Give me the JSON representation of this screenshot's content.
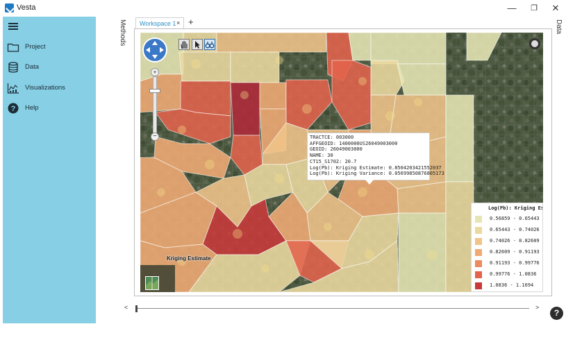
{
  "app": {
    "title": "Vesta"
  },
  "window_controls": {
    "minimize": "—",
    "restore": "❐",
    "close": "✕"
  },
  "sidebar": {
    "items": [
      {
        "label": "Project",
        "icon": "folder-icon"
      },
      {
        "label": "Data",
        "icon": "database-icon"
      },
      {
        "label": "Visualizations",
        "icon": "chart-icon"
      },
      {
        "label": "Help",
        "icon": "help-icon"
      }
    ]
  },
  "panels": {
    "methods": "Methods",
    "data": "Data"
  },
  "tabs": {
    "workspace": "Workspace 1",
    "close": "×",
    "add": "+"
  },
  "map": {
    "overlay_label": "Kriging Estimate",
    "tooltip": [
      "TRACTCE: 003000",
      "AFFGEOID: 1400000US26049003000",
      "GEOID: 26049003000",
      "NAME: 30",
      "CT15_S1702: 20.7",
      "Log(Pb): Kriging Estimate: 0.8504203421552037",
      "Log(Pb): Kriging Variance: 0.05699850876805173"
    ],
    "legend": {
      "title": "Log(Pb): Kriging Estimate",
      "items": [
        {
          "label": "0.56859 - 0.65443",
          "color": "#e6e6b4"
        },
        {
          "label": "0.65443 - 0.74026",
          "color": "#ecd9a0"
        },
        {
          "label": "0.74026 - 0.82609",
          "color": "#f0c48a"
        },
        {
          "label": "0.82609 - 0.91193",
          "color": "#f0ab74"
        },
        {
          "label": "0.91193 - 0.99776",
          "color": "#ec8a60"
        },
        {
          "label": "0.99776 - 1.0836",
          "color": "#e3634c"
        },
        {
          "label": "1.0836 - 1.1694",
          "color": "#c83a3a"
        }
      ]
    }
  },
  "timeline": {
    "prev": "<",
    "next": ">"
  },
  "help_fab": "?"
}
